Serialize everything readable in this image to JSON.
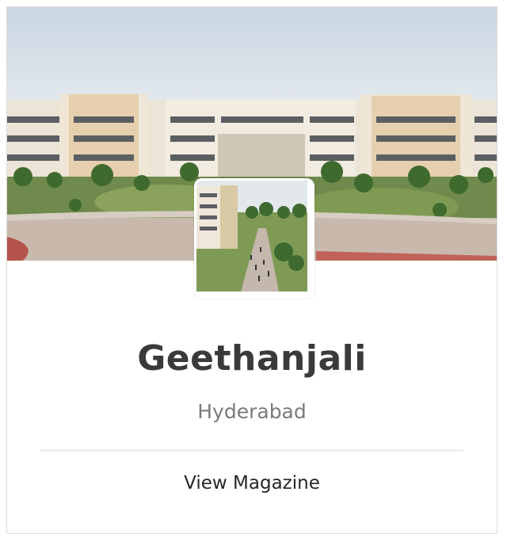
{
  "card": {
    "name": "Geethanjali",
    "location": "Hyderabad",
    "action_label": "View Magazine"
  },
  "images": {
    "cover": "campus-building-photo",
    "avatar": "campus-walkway-photo"
  },
  "colors": {
    "title": "#3a3a3a",
    "subtitle": "#7a7a7a",
    "link": "#262626",
    "divider": "#eeeeee",
    "border": "#dcdcdc"
  }
}
